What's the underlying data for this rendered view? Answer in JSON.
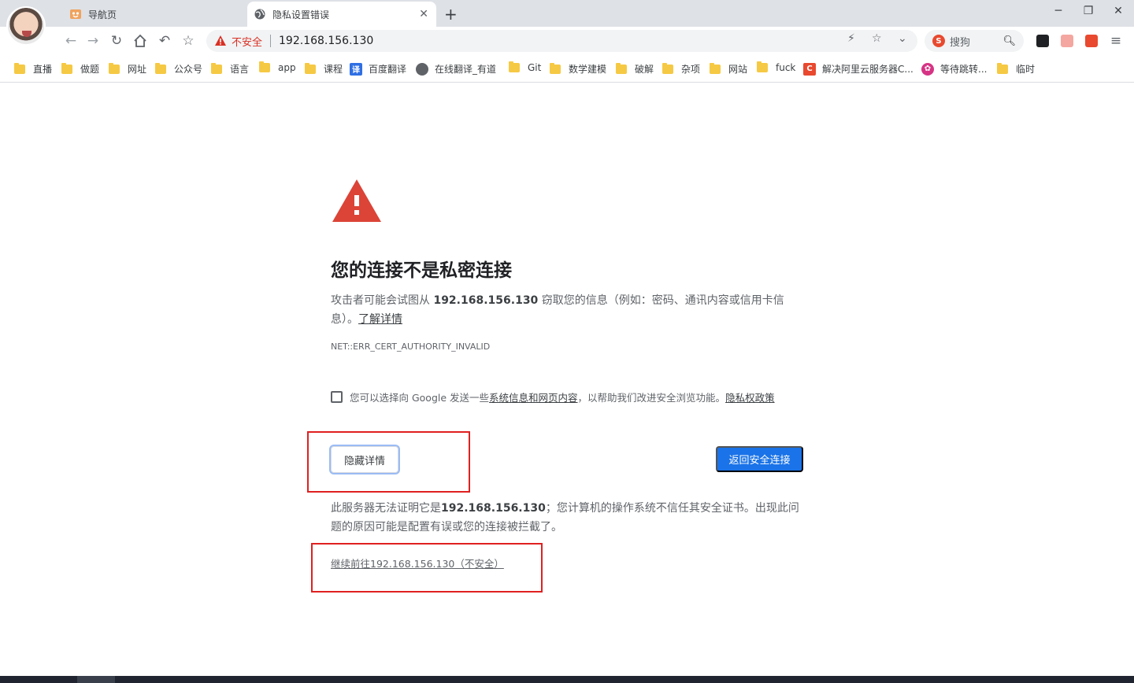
{
  "browser": {
    "tabs": [
      {
        "title": "导航页",
        "active": false
      },
      {
        "title": "隐私设置错误",
        "active": true
      }
    ],
    "address_bar": {
      "security_label": "不安全",
      "url": "192.168.156.130"
    },
    "search_box": {
      "placeholder": "搜狗"
    },
    "bookmarks": [
      {
        "label": "直播",
        "icon": "folder-icon"
      },
      {
        "label": "做题",
        "icon": "folder-icon"
      },
      {
        "label": "网址",
        "icon": "folder-icon"
      },
      {
        "label": "公众号",
        "icon": "folder-icon"
      },
      {
        "label": "语言",
        "icon": "folder-icon"
      },
      {
        "label": "app",
        "icon": "folder-icon"
      },
      {
        "label": "课程",
        "icon": "folder-icon"
      },
      {
        "label": "百度翻译",
        "icon": "baidu-translate-icon"
      },
      {
        "label": "在线翻译_有道",
        "icon": "globe-icon"
      },
      {
        "label": "Git",
        "icon": "folder-icon"
      },
      {
        "label": "数学建模",
        "icon": "folder-icon"
      },
      {
        "label": "破解",
        "icon": "folder-icon"
      },
      {
        "label": "杂项",
        "icon": "folder-icon"
      },
      {
        "label": "网站",
        "icon": "folder-icon"
      },
      {
        "label": "fuck",
        "icon": "folder-icon"
      },
      {
        "label": "解决阿里云服务器C...",
        "icon": "csdn-icon"
      },
      {
        "label": "等待跳转...",
        "icon": "flower-icon"
      },
      {
        "label": "临时",
        "icon": "folder-icon"
      }
    ],
    "colors": {
      "accent": "#1a73e8",
      "danger": "#d93025",
      "annotation": "#e02020"
    }
  },
  "page": {
    "heading": "您的连接不是私密连接",
    "intro_before": "攻击者可能会试图从 ",
    "intro_host": "192.168.156.130",
    "intro_after": " 窃取您的信息（例如：密码、通讯内容或信用卡信息）。",
    "learn_more": "了解详情",
    "error_code": "NET::ERR_CERT_AUTHORITY_INVALID",
    "checkbox_before": "您可以选择向 Google 发送一些",
    "checkbox_link": "系统信息和网页内容",
    "checkbox_after": "，以帮助我们改进安全浏览功能。",
    "privacy_link": "隐私权政策",
    "hide_details_button": "隐藏详情",
    "back_to_safety_button": "返回安全连接",
    "details_before": "此服务器无法证明它是",
    "details_host": "192.168.156.130",
    "details_after": "；您计算机的操作系统不信任其安全证书。出现此问题的原因可能是配置有误或您的连接被拦截了。",
    "proceed_link": "继续前往192.168.156.130（不安全）"
  }
}
